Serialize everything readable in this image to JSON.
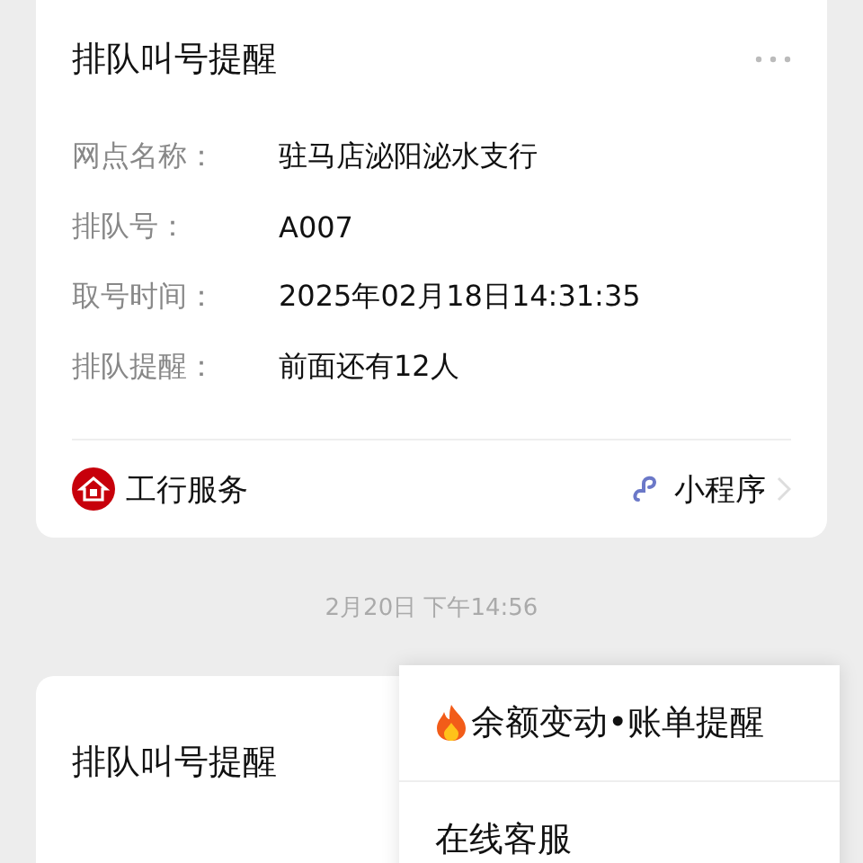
{
  "cards": [
    {
      "title": "排队叫号提醒",
      "fields": [
        {
          "label": "网点名称：",
          "value": "驻马店泌阳泌水支行"
        },
        {
          "label": "排队号：",
          "value": "A007"
        },
        {
          "label": "取号时间：",
          "value": "2025年02月18日14:31:35"
        },
        {
          "label": "排队提醒：",
          "value": "前面还有12人"
        }
      ],
      "footer": {
        "source": "工行服务",
        "link": "小程序"
      }
    },
    {
      "title": "排队叫号提醒"
    }
  ],
  "timestamp": "2月20日 下午14:56",
  "menu": [
    {
      "label": "余额变动•账单提醒",
      "kind": "hot"
    },
    {
      "label": "在线客服",
      "kind": "plain"
    }
  ]
}
